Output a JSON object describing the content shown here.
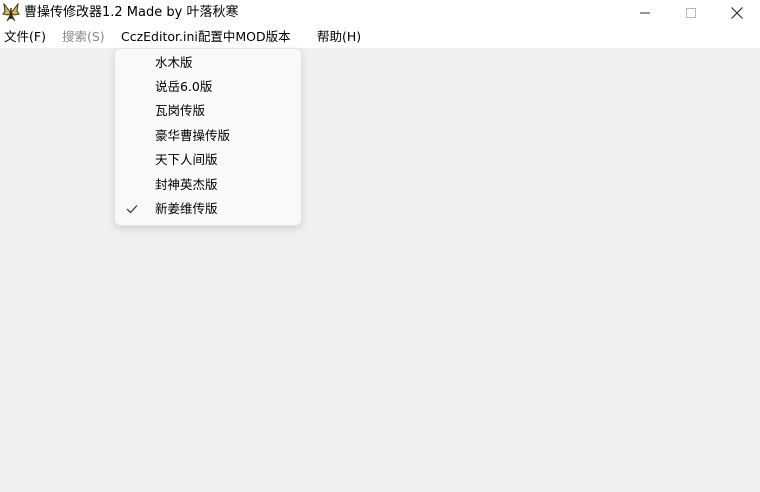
{
  "window": {
    "title": "曹操传修改器1.2 Made by 叶落秋寒",
    "app_icon": "butterfly-icon",
    "controls": [
      "minimize-icon",
      "maximize-icon",
      "close-icon"
    ]
  },
  "menubar": {
    "items": [
      {
        "label": "文件(F)",
        "enabled": true
      },
      {
        "label": "搜索(S)",
        "enabled": false
      },
      {
        "label": "CczEditor.ini配置中MOD版本",
        "enabled": true
      },
      {
        "label": "帮助(H)",
        "enabled": true
      }
    ]
  },
  "dropdown": {
    "items": [
      {
        "label": "水木版",
        "checked": false
      },
      {
        "label": "说岳6.0版",
        "checked": false
      },
      {
        "label": "瓦岗传版",
        "checked": false
      },
      {
        "label": "豪华曹操传版",
        "checked": false
      },
      {
        "label": "天下人间版",
        "checked": false
      },
      {
        "label": "封神英杰版",
        "checked": false
      },
      {
        "label": "新姜维传版",
        "checked": true
      }
    ]
  },
  "colors": {
    "titlebar_bg": "#ffffff",
    "client_bg": "#f0f0f0",
    "menu_disabled": "#8a8a8a",
    "dropdown_bg": "#f9f9f9"
  }
}
